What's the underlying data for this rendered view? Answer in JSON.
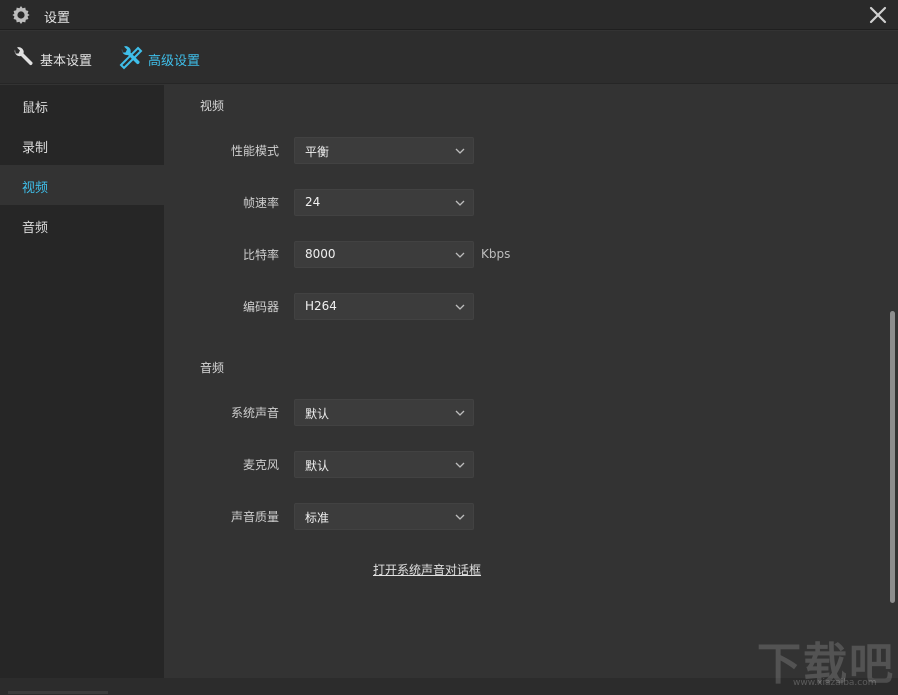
{
  "window": {
    "title": "设置",
    "icons": {
      "app": "gear-icon",
      "close": "close-icon"
    }
  },
  "tabs": [
    {
      "label": "基本设置",
      "icon": "wrench-icon",
      "active": false
    },
    {
      "label": "高级设置",
      "icon": "tools-icon",
      "active": true
    }
  ],
  "sidebar": {
    "items": [
      {
        "label": "鼠标",
        "active": false
      },
      {
        "label": "录制",
        "active": false
      },
      {
        "label": "视频",
        "active": true
      },
      {
        "label": "音频",
        "active": false
      }
    ]
  },
  "video": {
    "title": "视频",
    "performance": {
      "label": "性能模式",
      "value": "平衡"
    },
    "framerate": {
      "label": "帧速率",
      "value": "24"
    },
    "bitrate": {
      "label": "比特率",
      "value": "8000",
      "unit": "Kbps"
    },
    "encoder": {
      "label": "编码器",
      "value": "H264"
    }
  },
  "audio": {
    "title": "音频",
    "system_sound": {
      "label": "系统声音",
      "value": "默认"
    },
    "microphone": {
      "label": "麦克风",
      "value": "默认"
    },
    "quality": {
      "label": "声音质量",
      "value": "标准"
    },
    "open_dialog_link": "打开系统声音对话框"
  },
  "watermark": {
    "text": "下载吧",
    "site": "www.xiazaiba.com"
  },
  "colors": {
    "accent": "#3fbfea",
    "background": "#333333",
    "sidebar": "#262626",
    "control": "#3c3c3c"
  }
}
